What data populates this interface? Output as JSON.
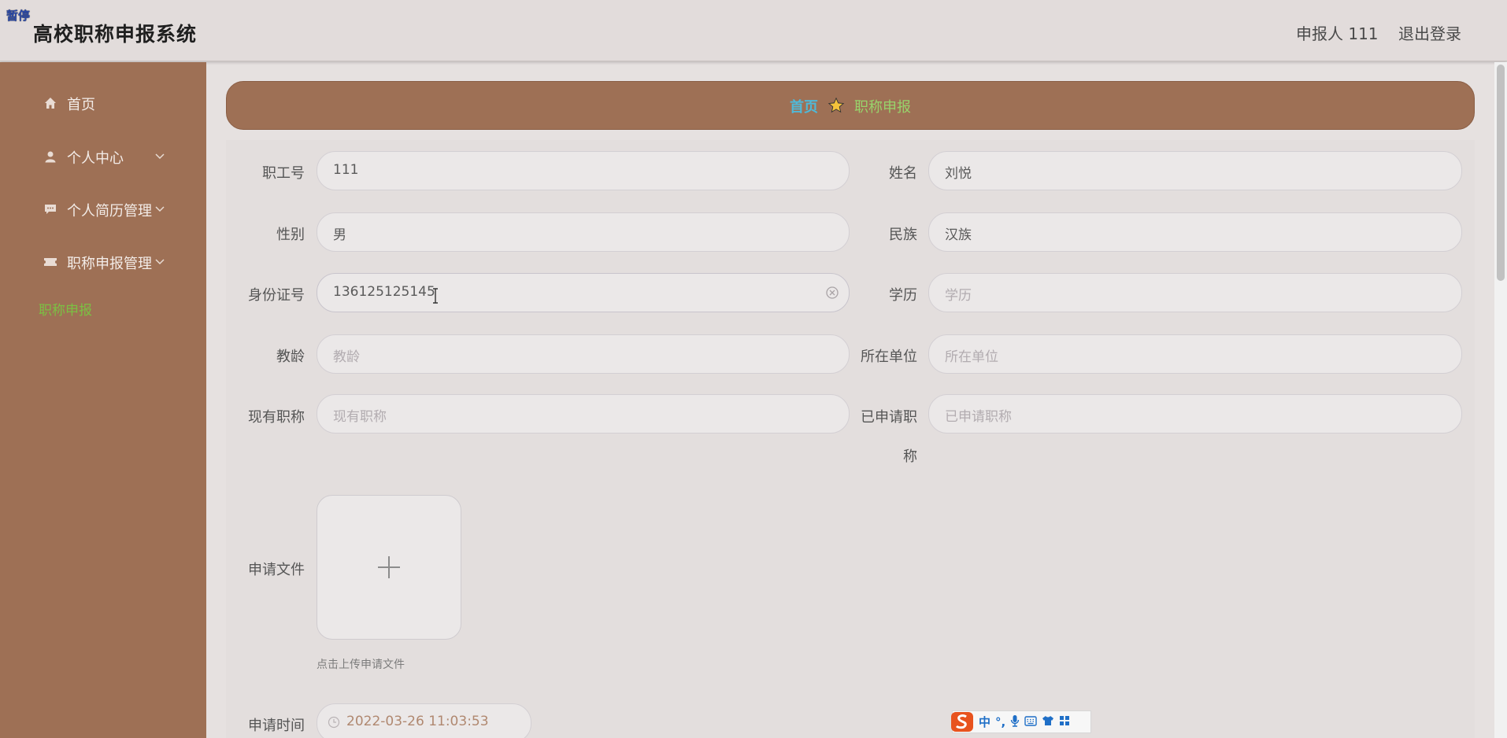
{
  "header": {
    "pause_badge": "暂停",
    "title": "高校职称申报系统",
    "user": "申报人 111",
    "logout": "退出登录"
  },
  "sidebar": {
    "items": [
      {
        "label": "首页",
        "icon": "home-icon"
      },
      {
        "label": "个人中心",
        "icon": "user-icon"
      },
      {
        "label": "个人简历管理",
        "icon": "chat-icon"
      },
      {
        "label": "职称申报管理",
        "icon": "ticket-icon"
      }
    ],
    "active_sub": "职称申报"
  },
  "breadcrumb": {
    "home": "首页",
    "current": "职称申报"
  },
  "form": {
    "employee_no": {
      "label": "职工号",
      "value": "111"
    },
    "name": {
      "label": "姓名",
      "value": "刘悦"
    },
    "gender": {
      "label": "性别",
      "value": "男"
    },
    "ethnicity": {
      "label": "民族",
      "value": "汉族"
    },
    "id_no": {
      "label": "身份证号",
      "value": "136125125145"
    },
    "education": {
      "label": "学历",
      "placeholder": "学历"
    },
    "teaching_years": {
      "label": "教龄",
      "placeholder": "教龄"
    },
    "unit": {
      "label": "所在单位",
      "placeholder": "所在单位"
    },
    "current_title": {
      "label": "现有职称",
      "placeholder": "现有职称"
    },
    "applied_title": {
      "label_line1": "已申请职",
      "label_line2": "称",
      "placeholder": "已申请职称"
    },
    "file": {
      "label": "申请文件",
      "tip": "点击上传申请文件"
    },
    "apply_time": {
      "label": "申请时间",
      "value": "2022-03-26 11:03:53"
    }
  },
  "ime": {
    "items": [
      "中",
      "°,",
      "🎤",
      "⌨",
      "👕",
      "▦"
    ]
  },
  "colors": {
    "sidebar_bg": "#9e7055",
    "accent_green": "#7bc043",
    "crumb_home": "#4fb9d8",
    "crumb_current": "#98d36b"
  }
}
